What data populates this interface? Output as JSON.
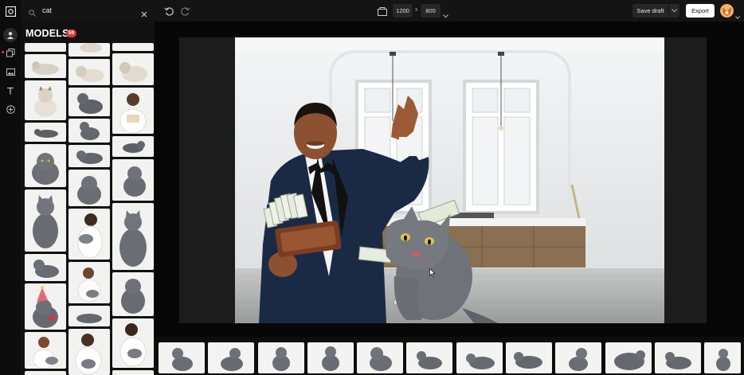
{
  "search": {
    "query": "cat"
  },
  "panel": {
    "title": "MODELS",
    "count": "59"
  },
  "toolbar": {
    "width": "1200",
    "times": "x",
    "height": "800",
    "save_label": "Save draft",
    "export_label": "Export"
  },
  "colors": {
    "accent": "#e0343d",
    "cat": "#6f7278",
    "suit": "#1b2a44"
  },
  "icons": [
    "logo-icon",
    "user-icon",
    "pages-icon",
    "image-icon",
    "text-icon",
    "add-icon",
    "search-icon",
    "close-icon",
    "undo-icon",
    "redo-icon",
    "resize-icon",
    "chevron-down-icon"
  ]
}
